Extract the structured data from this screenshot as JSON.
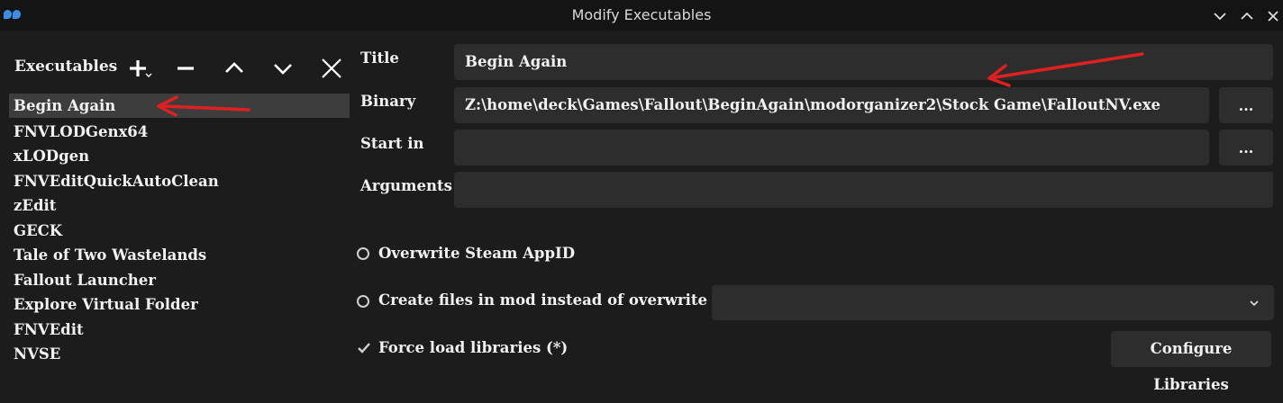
{
  "window": {
    "title": "Modify Executables"
  },
  "executables": {
    "label": "Executables",
    "items": [
      "Begin Again",
      "FNVLODGenx64",
      "xLODgen",
      "FNVEditQuickAutoClean",
      "zEdit",
      "GECK",
      "Tale of Two Wastelands",
      "Fallout Launcher",
      "Explore Virtual Folder",
      "FNVEdit",
      "NVSE"
    ],
    "selected_index": 0
  },
  "form": {
    "title_label": "Title",
    "title_value": "Begin Again",
    "binary_label": "Binary",
    "binary_value": "Z:\\home\\deck\\Games\\Fallout\\BeginAgain\\modorganizer2\\Stock Game\\FalloutNV.exe",
    "start_in_label": "Start in",
    "start_in_value": "",
    "arguments_label": "Arguments",
    "arguments_value": "",
    "browse_label": "..."
  },
  "options": {
    "overwrite_appid": "Overwrite Steam AppID",
    "create_files_in_mod": "Create files in mod instead of overwrite (*)",
    "force_load": "Force load libraries (*)",
    "configure_libraries": "Configure Libraries"
  },
  "colors": {
    "annotation_arrow": "#e02020",
    "selection": "#3d3d3d",
    "field_bg": "#2d2d2d"
  }
}
